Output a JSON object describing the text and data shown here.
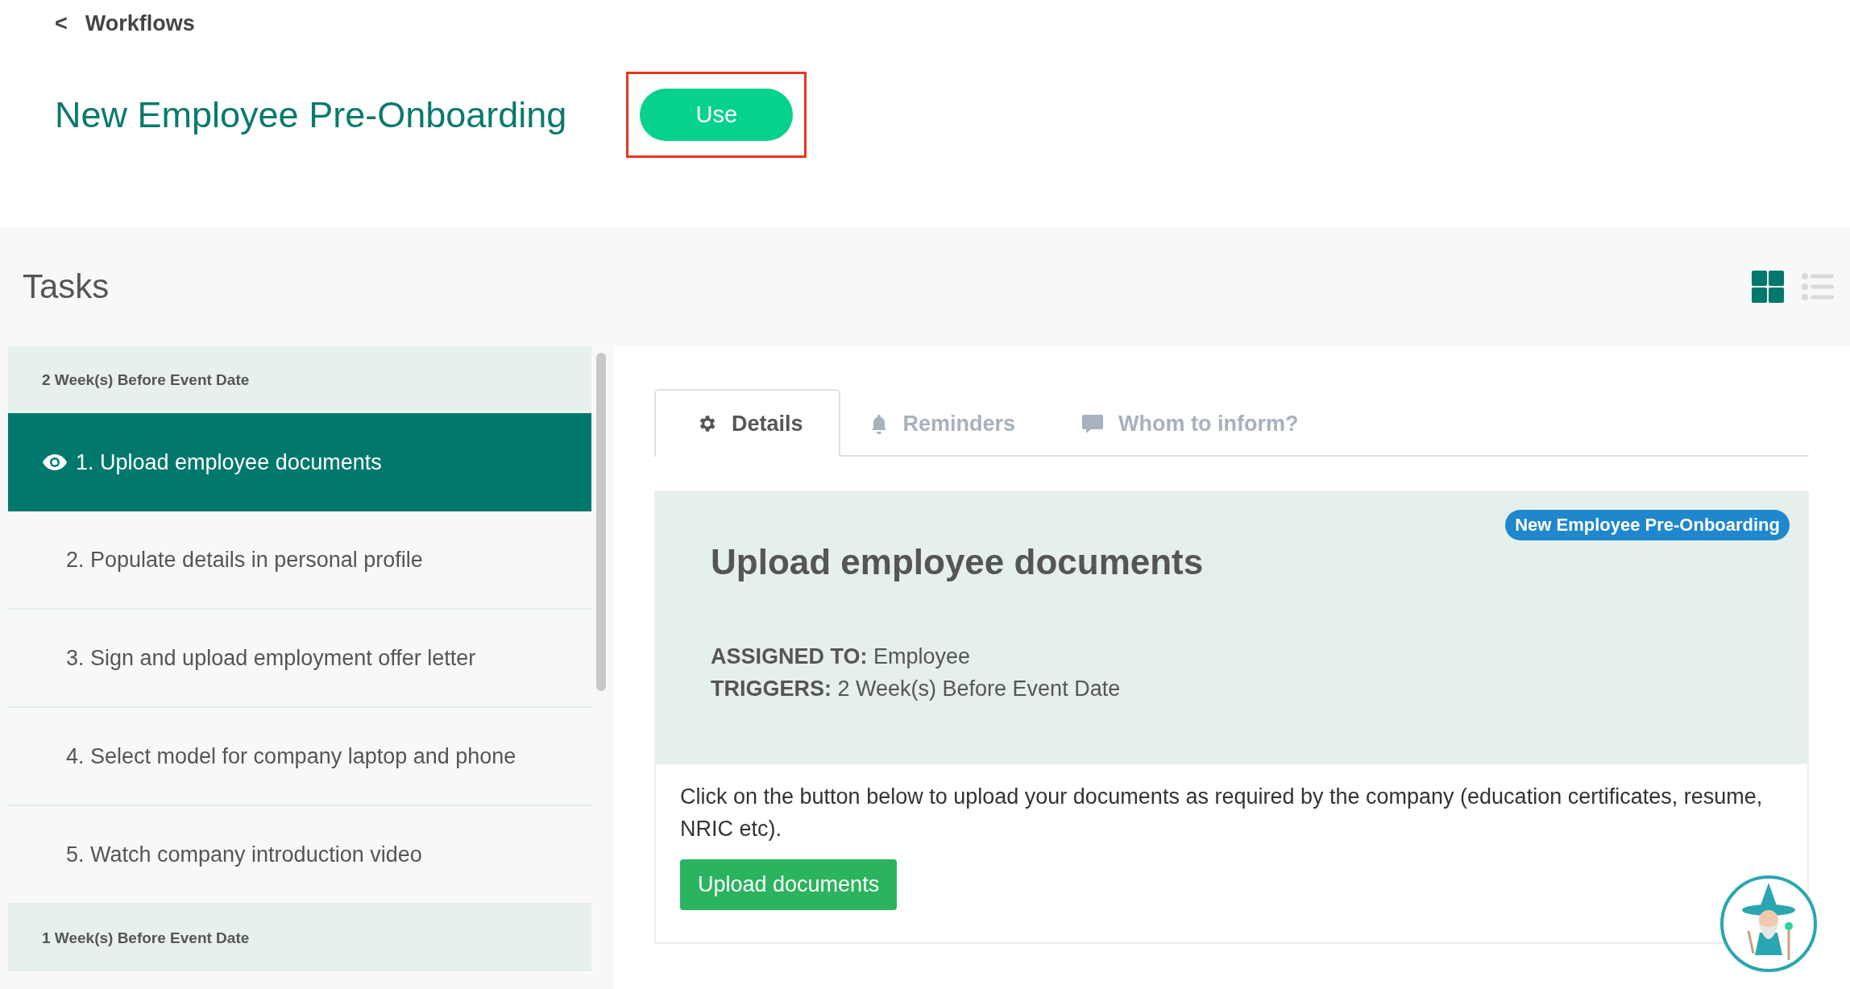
{
  "breadcrumb": {
    "back": "<",
    "label": "Workflows"
  },
  "workflow": {
    "title": "New Employee Pre-Onboarding",
    "use_button": {
      "label": "Use",
      "highlighted": true
    }
  },
  "tasks": {
    "title": "Tasks",
    "views": [
      {
        "kind": "grid",
        "selected": true
      },
      {
        "kind": "list",
        "selected": false
      }
    ],
    "groups": [
      {
        "label": "2 Week(s) Before Event Date",
        "items": [
          {
            "label": "1. Upload employee documents",
            "selected": true
          },
          {
            "label": "2. Populate details in personal profile",
            "selected": false
          },
          {
            "label": "3. Sign and upload employment offer letter",
            "selected": false
          },
          {
            "label": "4. Select model for company laptop and phone",
            "selected": false
          },
          {
            "label": "5. Watch company introduction video",
            "selected": false
          }
        ]
      },
      {
        "label": "1 Week(s) Before Event Date"
      }
    ]
  },
  "detail": {
    "tabs": [
      {
        "kind": "gear",
        "label": "Details",
        "selected": true
      },
      {
        "kind": "bell",
        "label": "Reminders",
        "selected": false
      },
      {
        "kind": "comment",
        "label": "Whom to inform?",
        "selected": false
      }
    ],
    "badge": "New Employee Pre-Onboarding",
    "heading": "Upload employee documents",
    "fields": [
      {
        "label": "ASSIGNED TO:",
        "value": "Employee"
      },
      {
        "label": "TRIGGERS:",
        "value": "2 Week(s) Before Event Date"
      }
    ],
    "description": "Click on the button below to upload your documents as required by the company (education certificates, resume, NRIC etc).",
    "action_button": "Upload documents"
  }
}
